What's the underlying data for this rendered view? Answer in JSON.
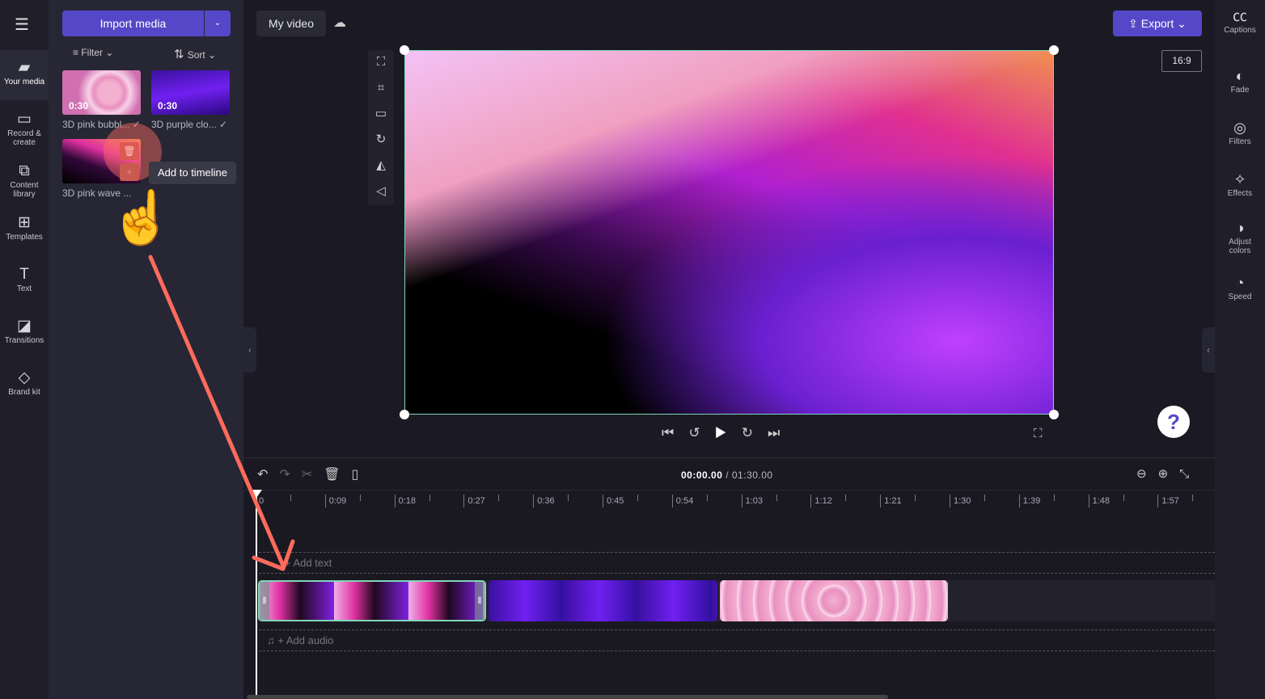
{
  "nav": {
    "items": [
      {
        "label": "Your media",
        "icon": "folder-icon",
        "active": true
      },
      {
        "label": "Record & create",
        "icon": "camera-icon"
      },
      {
        "label": "Content library",
        "icon": "content-library-icon"
      },
      {
        "label": "Templates",
        "icon": "templates-icon"
      },
      {
        "label": "Text",
        "icon": "text-icon"
      },
      {
        "label": "Transitions",
        "icon": "transitions-icon"
      },
      {
        "label": "Brand kit",
        "icon": "brand-kit-icon"
      }
    ]
  },
  "media": {
    "import_label": "Import media",
    "filter_label": "Filter",
    "sort_label": "Sort",
    "items": [
      {
        "name": "3D pink bubbl...",
        "duration": "0:30"
      },
      {
        "name": "3D purple clo...",
        "duration": "0:30"
      },
      {
        "name": "3D pink wave ..."
      }
    ],
    "tooltip": "Add to timeline"
  },
  "header": {
    "title": "My video",
    "export_label": "Export",
    "aspect": "16:9"
  },
  "right": {
    "items": [
      {
        "label": "Captions",
        "icon": "captions-icon"
      },
      {
        "label": "Fade",
        "icon": "fade-icon"
      },
      {
        "label": "Filters",
        "icon": "filters-icon"
      },
      {
        "label": "Effects",
        "icon": "effects-icon"
      },
      {
        "label": "Adjust colors",
        "icon": "adjust-colors-icon"
      },
      {
        "label": "Speed",
        "icon": "speed-icon"
      }
    ]
  },
  "timeline": {
    "current": "00:00.00",
    "total": "/ 01:30.00",
    "ticks": [
      "0",
      "0:09",
      "0:18",
      "0:27",
      "0:36",
      "0:45",
      "0:54",
      "1:03",
      "1:12",
      "1:21",
      "1:30",
      "1:39",
      "1:48",
      "1:57"
    ],
    "add_text": "+ Add text",
    "add_audio": "+ Add audio"
  },
  "colors": {
    "accent": "#5448c8",
    "selection": "#7fd6b8",
    "annotation": "#ff6b5b"
  }
}
